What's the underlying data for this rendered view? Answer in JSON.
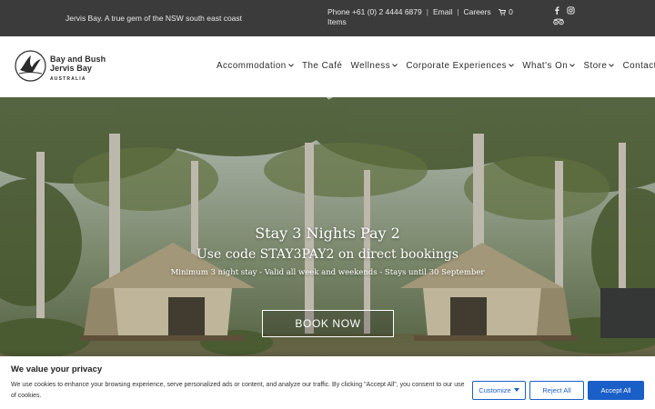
{
  "topbar": {
    "tagline": "Jervis Bay. A true gem of the NSW south east coast",
    "phone": "Phone +61 (0) 2 4444 6879",
    "email": "Email",
    "careers": "Careers",
    "cart": "0",
    "cart_items": "Items",
    "separator": "|",
    "icons": [
      "facebook-icon",
      "instagram-icon",
      "tripadvisor-icon"
    ]
  },
  "logo": {
    "line1": "Bay and Bush",
    "line2": "Jervis Bay",
    "line3": "AUSTRALIA"
  },
  "nav": {
    "items": [
      {
        "label": "Accommodation",
        "has_dropdown": true
      },
      {
        "label": "The Café",
        "has_dropdown": false
      },
      {
        "label": "Wellness",
        "has_dropdown": true
      },
      {
        "label": "Corporate Experiences",
        "has_dropdown": true
      },
      {
        "label": "What's On",
        "has_dropdown": true
      },
      {
        "label": "Store",
        "has_dropdown": true
      },
      {
        "label": "Contact Us",
        "has_dropdown": true
      }
    ]
  },
  "hero": {
    "title": "Stay 3 Nights Pay 2",
    "subtitle": "Use code STAY3PAY2 on direct bookings",
    "note": "Minimum 3 night stay - Valid all week and weekends - Stays until 30 September",
    "cta": "BOOK NOW"
  },
  "cookie": {
    "title": "We value your privacy",
    "text": "We use cookies to enhance your browsing experience, serve personalized ads or content, and analyze our traffic. By clicking \"Accept All\", you consent to our use of cookies.",
    "customize": "Customize",
    "reject": "Reject All",
    "accept": "Accept All"
  },
  "colors": {
    "topbar_bg": "#3a3b3a",
    "accent_blue": "#1a5fc7"
  }
}
